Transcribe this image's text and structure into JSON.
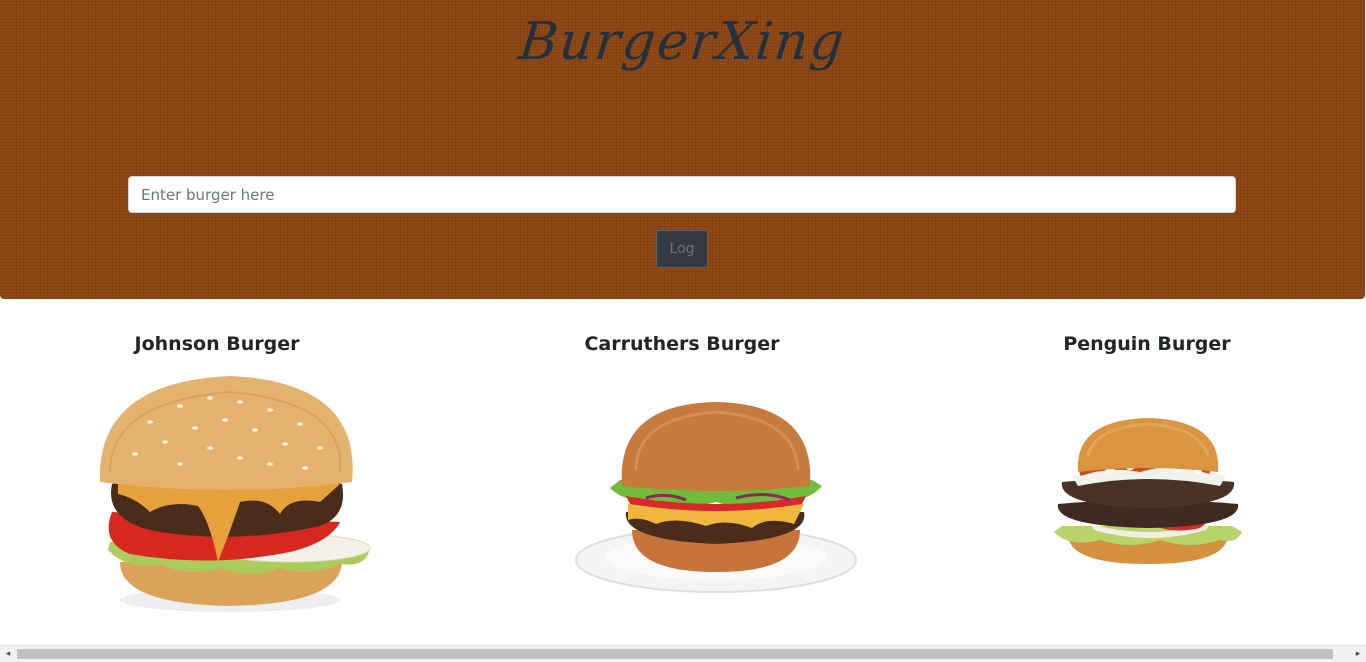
{
  "header": {
    "brand": "BurgerXing",
    "background_color": "#8b4513"
  },
  "form": {
    "input_placeholder": "Enter burger here",
    "input_value": "",
    "submit_label": "Log"
  },
  "burgers": [
    {
      "name": "Johnson Burger",
      "image": "burger-cheese-sesame-bun"
    },
    {
      "name": "Carruthers Burger",
      "image": "burger-on-plate"
    },
    {
      "name": "Penguin Burger",
      "image": "burger-double-patty-blue-cheese"
    }
  ],
  "scrollbar": {
    "left_arrow_icon": "triangle-left-icon",
    "right_arrow_icon": "triangle-right-icon"
  }
}
